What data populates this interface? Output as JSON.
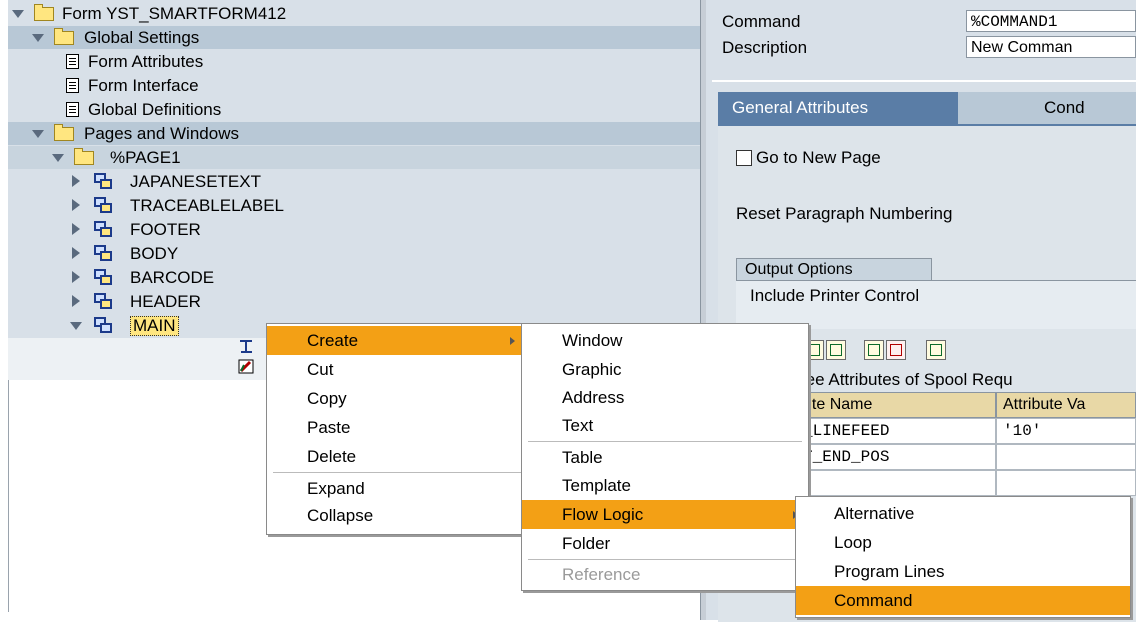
{
  "tree": {
    "items": [
      {
        "label": "Form YST_SMARTFORM412"
      },
      {
        "label": "Global Settings"
      },
      {
        "label": "Form Attributes"
      },
      {
        "label": "Form Interface"
      },
      {
        "label": "Global Definitions"
      },
      {
        "label": "Pages and Windows"
      },
      {
        "label": "%PAGE1"
      },
      {
        "label": "JAPANESETEXT"
      },
      {
        "label": "TRACEABLELABEL"
      },
      {
        "label": "FOOTER"
      },
      {
        "label": "BODY"
      },
      {
        "label": "BARCODE"
      },
      {
        "label": "HEADER"
      },
      {
        "label": "MAIN"
      }
    ]
  },
  "details": {
    "command_label": "Command",
    "command_value": "%COMMAND1",
    "description_label": "Description",
    "description_value": "New Comman",
    "tabs": [
      "General Attributes",
      "Cond"
    ],
    "goto_new_page": "Go to New Page",
    "reset_paragraph": "Reset Paragraph Numbering",
    "output_options_tab": "Output Options",
    "include_printer_control": "Include Printer Control",
    "table_title": "ree Attributes of Spool Requ",
    "columns": [
      "ute Name",
      "Attribute Va"
    ],
    "rows": [
      [
        "_LINEFEED",
        "'10'"
      ],
      [
        "T_END_POS",
        ""
      ]
    ]
  },
  "context_menu": {
    "items": [
      "Create",
      "Cut",
      "Copy",
      "Paste",
      "Delete",
      "Expand",
      "Collapse"
    ]
  },
  "create_submenu": {
    "items": [
      "Window",
      "Graphic",
      "Address",
      "Text",
      "Table",
      "Template",
      "Flow Logic",
      "Folder",
      "Reference"
    ]
  },
  "flow_logic_submenu": {
    "items": [
      "Alternative",
      "Loop",
      "Program Lines",
      "Command"
    ]
  },
  "colors": {
    "highlight": "#f3a015",
    "tree_background": "#d8e0e8",
    "tab_active": "#5a7da6"
  }
}
